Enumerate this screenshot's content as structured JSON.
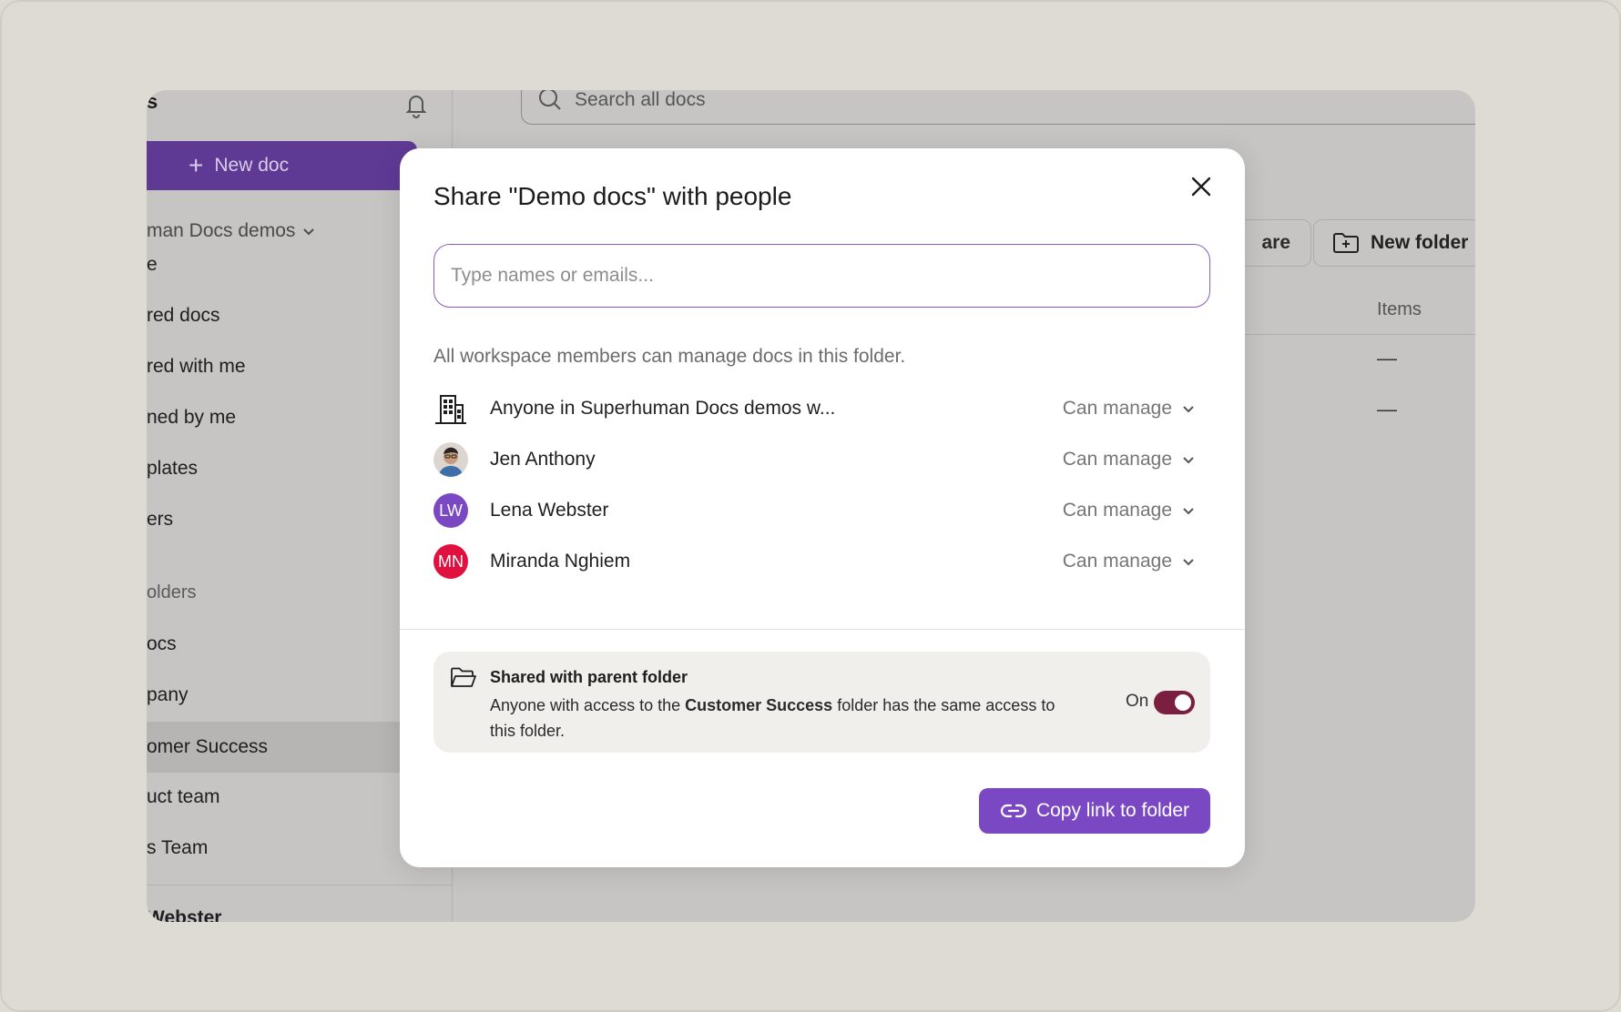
{
  "sidebar": {
    "title_fragment": "s",
    "new_doc_label": "New doc",
    "workspace_label": "man Docs demos",
    "items": [
      "e",
      "red docs",
      "red with me",
      "ned by me",
      "plates",
      "ers"
    ],
    "section_label": "olders",
    "folders": [
      "ocs",
      "pany",
      "omer Success",
      "uct team",
      "s Team"
    ],
    "bottom_user": "Webster"
  },
  "main": {
    "search_placeholder": "Search all docs",
    "share_label": "are",
    "new_folder_label": "New folder",
    "col_items": "Items",
    "dash_values": [
      "—",
      "—"
    ]
  },
  "modal": {
    "title": "Share \"Demo docs\" with people",
    "input_placeholder": "Type names or emails...",
    "info_text": "All workspace members can manage docs in this folder.",
    "members": [
      {
        "name": "Anyone in Superhuman Docs demos w...",
        "initials": "",
        "avatar": "building",
        "permission": "Can manage"
      },
      {
        "name": "Jen Anthony",
        "initials": "",
        "avatar": "photo",
        "permission": "Can manage"
      },
      {
        "name": "Lena Webster",
        "initials": "LW",
        "avatar": "initials",
        "color": "#7b48c3",
        "permission": "Can manage"
      },
      {
        "name": "Miranda Nghiem",
        "initials": "MN",
        "avatar": "initials",
        "color": "#e0113f",
        "permission": "Can manage"
      }
    ],
    "parent": {
      "title": "Shared with parent folder",
      "desc_before": "Anyone with access to the ",
      "desc_bold": "Customer Success",
      "desc_after": " folder has the same access to this folder.",
      "toggle_label": "On",
      "toggle_on": true
    },
    "copy_link_label": "Copy link to folder"
  },
  "colors": {
    "accent": "#7b48c3",
    "sidebar_button": "#5f3a95",
    "toggle": "#7a1f40",
    "mn_avatar": "#e0113f"
  }
}
